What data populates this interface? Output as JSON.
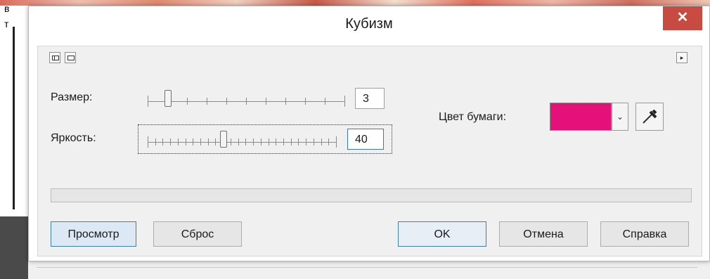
{
  "window": {
    "title": "Кубизм",
    "close_glyph": "✕"
  },
  "background": {
    "fragments": [
      "в",
      "т",
      "в"
    ]
  },
  "toolbar": {
    "left_icons": [
      "split-view-icon",
      "single-view-icon"
    ],
    "expand_arrow": "▸"
  },
  "controls": {
    "size": {
      "label": "Размер:",
      "value": "3",
      "slider_level": 0.1
    },
    "brightness": {
      "label": "Яркость:",
      "value": "40",
      "slider_level": 0.4
    },
    "paper_color": {
      "label": "Цвет бумаги:",
      "color": "#e5117a",
      "dropdown_glyph": "⌄"
    }
  },
  "progress": {
    "value": 0
  },
  "buttons": {
    "preview": "Просмотр",
    "reset": "Сброс",
    "ok": "OK",
    "cancel": "Отмена",
    "help": "Справка"
  },
  "colors": {
    "accent": "#3c7fb1",
    "close": "#c74b40",
    "paper": "#e5117a"
  }
}
